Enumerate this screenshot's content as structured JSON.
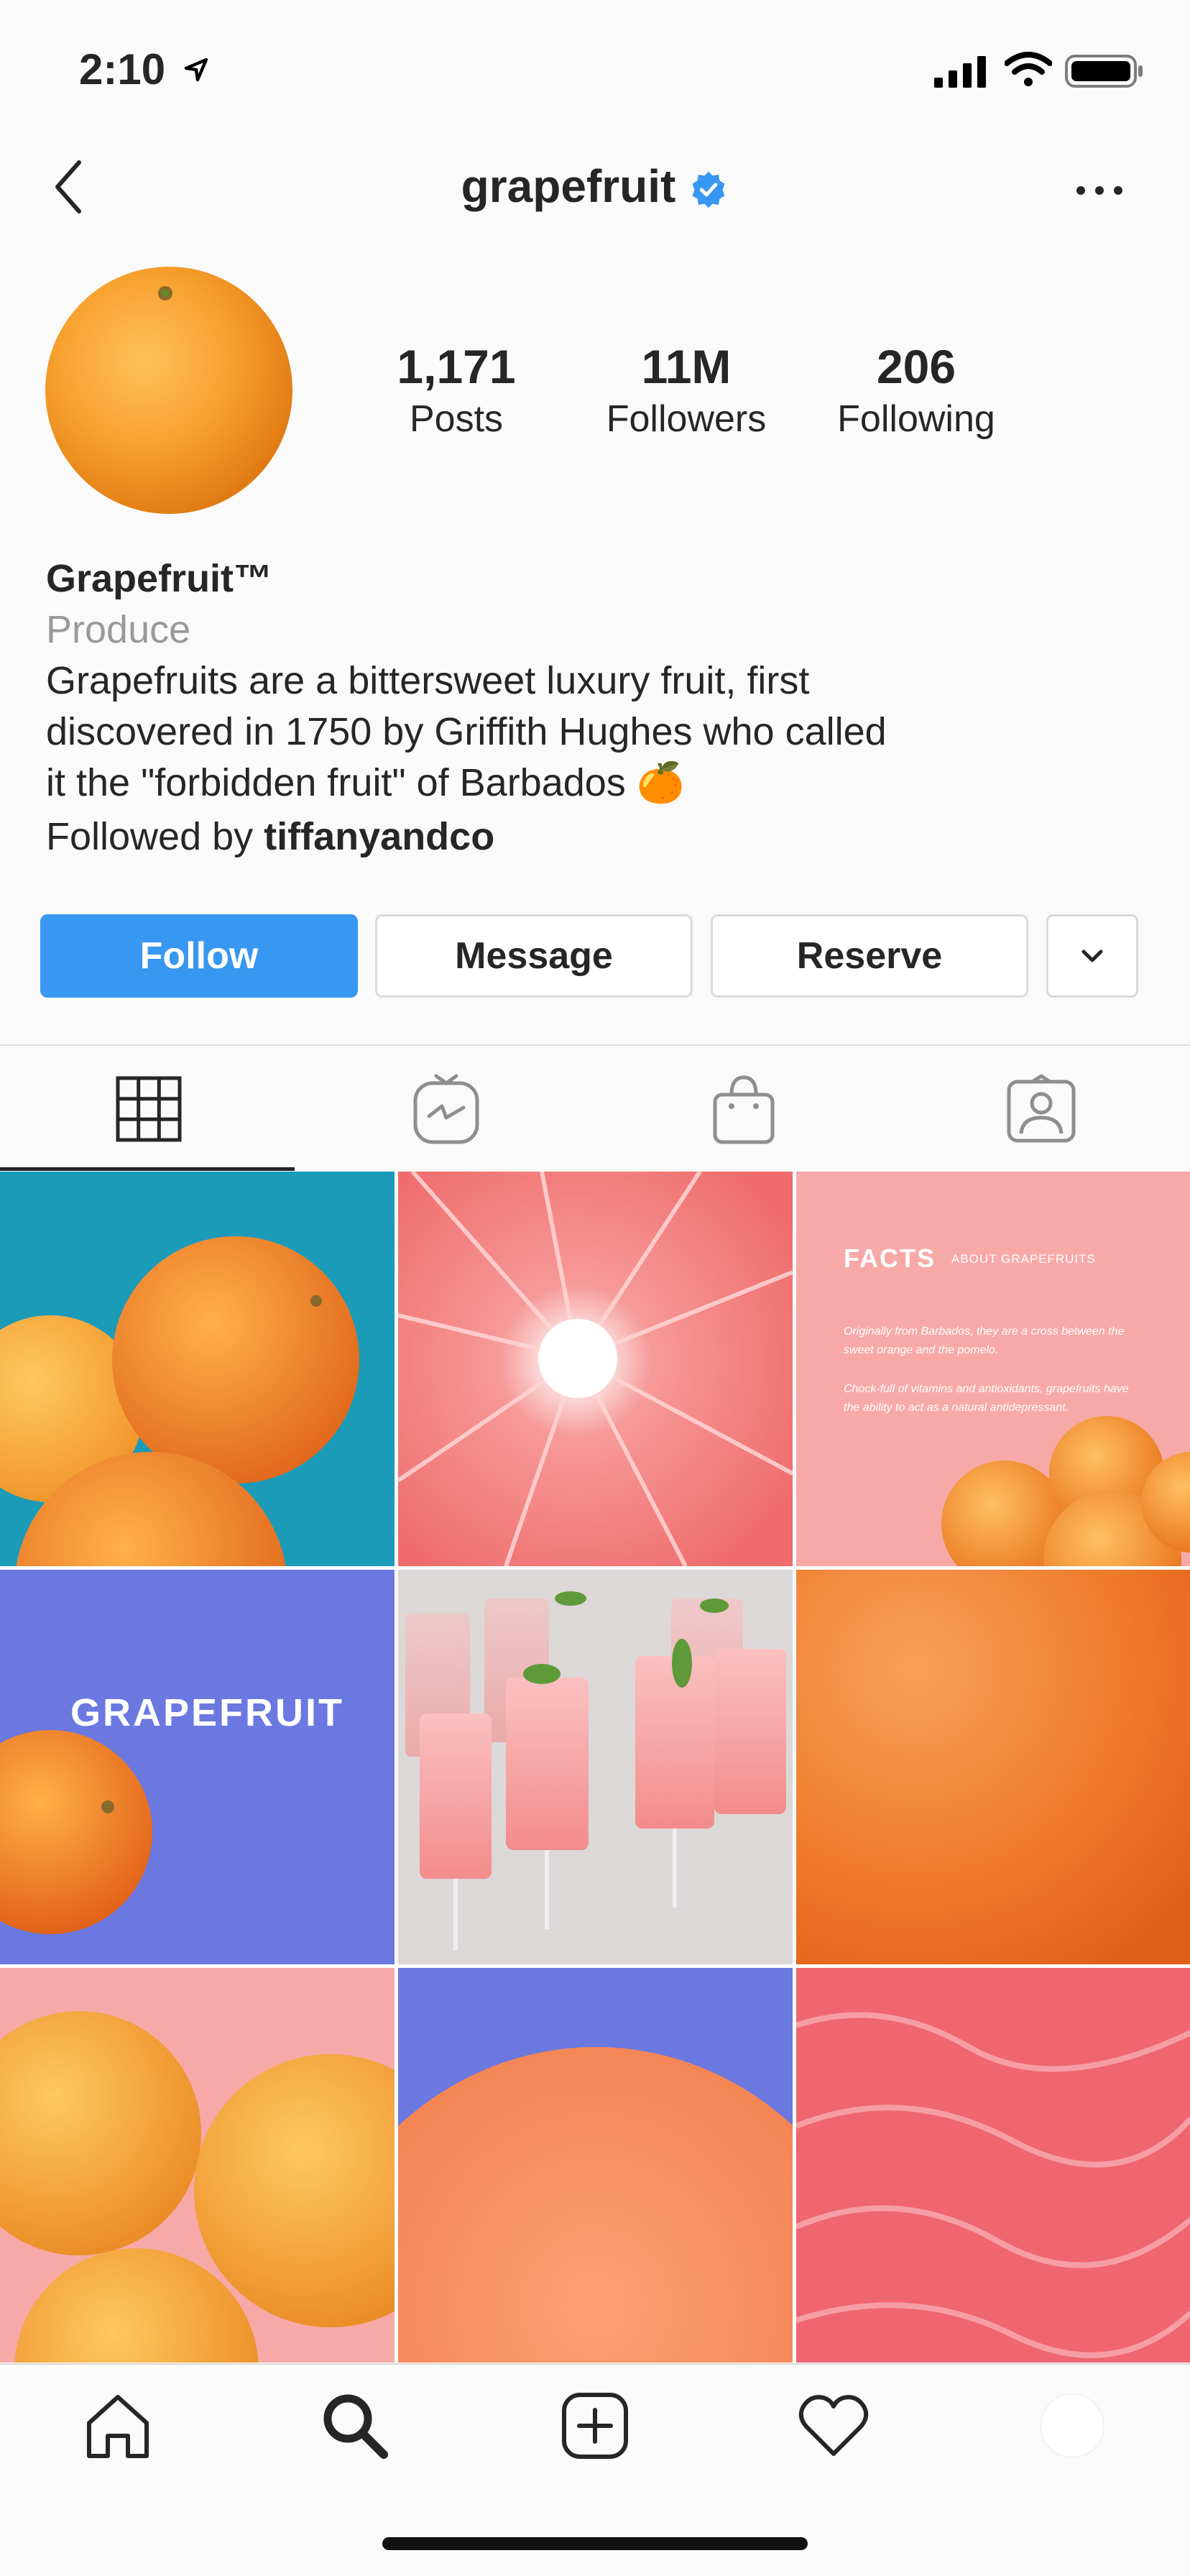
{
  "status_bar": {
    "time": "2:10"
  },
  "header": {
    "username": "grapefruit",
    "verified": true
  },
  "profile": {
    "stats": [
      {
        "value": "1,171",
        "label": "Posts"
      },
      {
        "value": "11M",
        "label": "Followers"
      },
      {
        "value": "206",
        "label": "Following"
      }
    ],
    "display_name": "Grapefruit™",
    "category": "Produce",
    "bio_lines": [
      "Grapefruits are a bittersweet luxury fruit, first",
      "discovered in 1750 by Griffith Hughes who called",
      "it the \"forbidden fruit\" of Barbados 🍊"
    ],
    "followed_by_prefix": "Followed by",
    "followed_by_user": "tiffanyandco"
  },
  "actions": {
    "follow": "Follow",
    "message": "Message",
    "reserve": "Reserve"
  },
  "tabs": [
    "grid-icon",
    "igtv-icon",
    "shop-icon",
    "tagged-icon"
  ],
  "posts": {
    "facts_title": "FACTS",
    "facts_subtitle": "ABOUT GRAPEFRUITS",
    "facts_p1": "Originally from Barbados, they are a cross between the sweet orange and the pomelo.",
    "facts_p2": "Chock-full of vitamins and antioxidants, grapefruits have the ability to act as a natural antidepressant.",
    "brand_text": "GRAPEFRUIT"
  },
  "colors": {
    "accent": "#3897f0",
    "verified": "#3897f0",
    "teal": "#1b9bb8",
    "pink": "#f7a9a8",
    "periwinkle": "#6a78e0"
  },
  "bottom_nav": [
    "home-icon",
    "search-icon",
    "new-post-icon",
    "activity-icon",
    "profile-avatar"
  ]
}
